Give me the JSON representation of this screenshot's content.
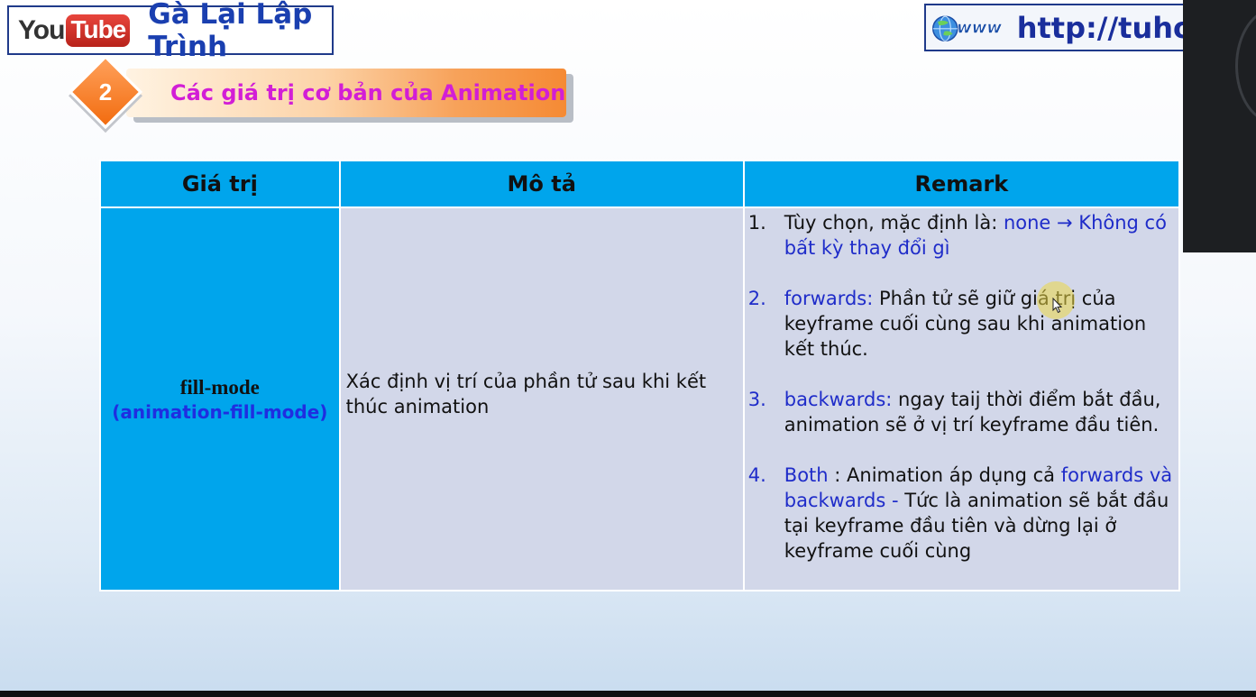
{
  "header": {
    "youtube_logo": {
      "you": "You",
      "tube": "Tube"
    },
    "channel_name": "Gà Lại Lập Trình",
    "website_icon": "www-globe-icon",
    "website_url": "http://tuho"
  },
  "section": {
    "number": "2",
    "title": "Các giá trị cơ bản của Animation"
  },
  "table": {
    "headers": [
      "Giá trị",
      "Mô tả",
      "Remark"
    ],
    "row": {
      "value_main": "fill-mode",
      "value_sub": "(animation-fill-mode)",
      "description": "Xác định vị trí của phần tử sau khi kết thúc animation",
      "remarks": [
        {
          "num": "1.",
          "parts": [
            {
              "text": "Tùy chọn, mặc định là: ",
              "blue": false
            },
            {
              "text": "none → Không có bất kỳ thay đổi gì",
              "blue": true
            }
          ]
        },
        {
          "num": "2.",
          "parts": [
            {
              "text": "forwards:",
              "blue": true
            },
            {
              "text": " Phần tử sẽ giữ giá trị của keyframe cuối cùng sau khi animation kết thúc.",
              "blue": false
            }
          ]
        },
        {
          "num": "3.",
          "parts": [
            {
              "text": "backwards:",
              "blue": true
            },
            {
              "text": " ngay taij thời điểm bắt đầu, animation sẽ ở vị trí keyframe đầu tiên.",
              "blue": false
            }
          ]
        },
        {
          "num": "4.",
          "parts": [
            {
              "text": "Both",
              "blue": true
            },
            {
              "text": " : Animation áp dụng cả ",
              "blue": false
            },
            {
              "text": "forwards và backwards",
              "blue": true
            },
            {
              "text": "  - ",
              "blue": true
            },
            {
              "text": "Tức là animation sẽ bắt đầu tại keyframe đầu tiên và dừng lại ở keyframe cuối cùng",
              "blue": false
            }
          ]
        }
      ]
    }
  },
  "colors": {
    "header_cell": "#00a5ec",
    "body_cell": "#d2d7e9",
    "title_magenta": "#d21ed6",
    "remark_blue": "#1f2cc9"
  }
}
